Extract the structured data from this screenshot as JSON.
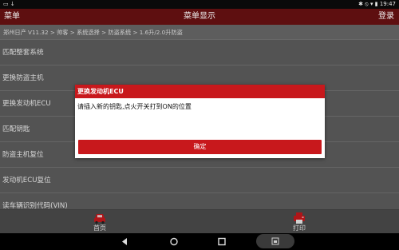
{
  "statusbar": {
    "left_icons": "▭ ↓",
    "right_icons": "✱ ⦸ ▾ ▮",
    "time": "19:47"
  },
  "titlebar": {
    "menu_label": "菜单",
    "title": "菜单显示",
    "lang_label": "登录"
  },
  "breadcrumb": "郑州日产 V11.32 > 帅客 > 系统选择 > 防盗系统 > 1.6升/2.0升防盗",
  "list": {
    "items": [
      {
        "label": "匹配整套系统"
      },
      {
        "label": "更换防盗主机"
      },
      {
        "label": "更换发动机ECU"
      },
      {
        "label": "匹配钥匙"
      },
      {
        "label": "防盗主机复位"
      },
      {
        "label": "发动机ECU复位"
      },
      {
        "label": "读车辆识别代码(VIN)"
      }
    ]
  },
  "bottombar": {
    "home_label": "首页",
    "print_label": "打印"
  },
  "dialog": {
    "title": "更换发动机ECU",
    "message": "请插入新的钥匙,点火开关打到ON的位置",
    "ok_label": "确定"
  },
  "colors": {
    "title_bar": "#5e0f10",
    "accent_red": "#c8181c",
    "list_bg": "#5f5f5f"
  }
}
